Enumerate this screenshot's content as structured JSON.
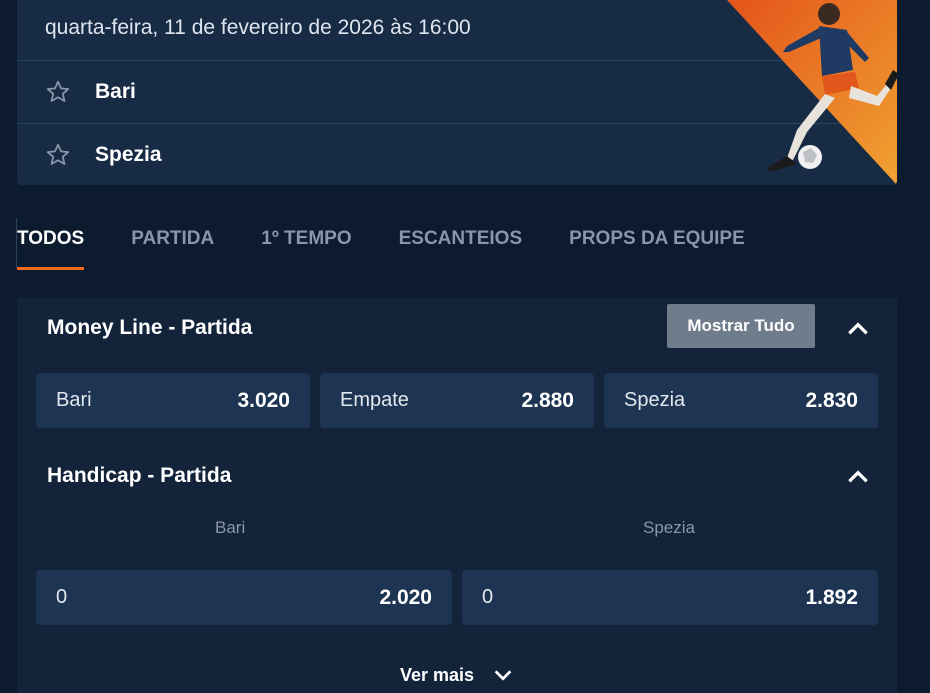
{
  "match": {
    "date": "quarta-feira, 11 de fevereiro de 2026 às 16:00",
    "home_team": "Bari",
    "away_team": "Spezia"
  },
  "tabs": [
    {
      "label": "TODOS",
      "active": true
    },
    {
      "label": "PARTIDA",
      "active": false
    },
    {
      "label": "1º TEMPO",
      "active": false
    },
    {
      "label": "ESCANTEIOS",
      "active": false
    },
    {
      "label": "PROPS DA EQUIPE",
      "active": false
    }
  ],
  "money_line": {
    "title": "Money Line - Partida",
    "show_all_label": "Mostrar Tudo",
    "odds": [
      {
        "label": "Bari",
        "value": "3.020"
      },
      {
        "label": "Empate",
        "value": "2.880"
      },
      {
        "label": "Spezia",
        "value": "2.830"
      }
    ]
  },
  "handicap": {
    "title": "Handicap - Partida",
    "col_home": "Bari",
    "col_away": "Spezia",
    "odds": [
      {
        "label": "0",
        "value": "2.020"
      },
      {
        "label": "0",
        "value": "1.892"
      }
    ],
    "more_label": "Ver mais"
  },
  "colors": {
    "background": "#0c1b2e",
    "card": "#172b45",
    "accent": "#f26a1e",
    "odd_button": "#1d3452"
  }
}
